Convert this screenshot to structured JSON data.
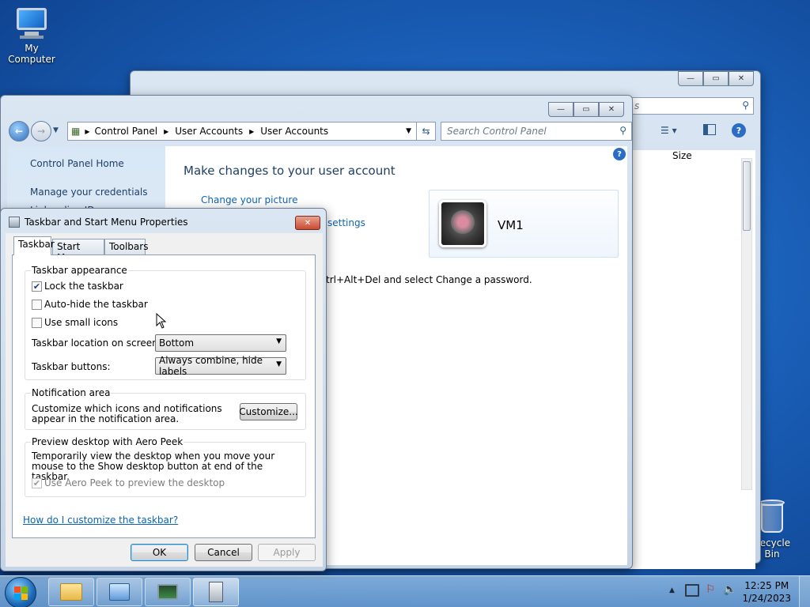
{
  "desktop": {
    "icons": [
      {
        "label": "My Computer"
      },
      {
        "label": "Recycle Bin"
      }
    ]
  },
  "explorer_window": {
    "search_partial": "s",
    "column_size": "Size"
  },
  "control_panel": {
    "breadcrumb": [
      "Control Panel",
      "User Accounts",
      "User Accounts"
    ],
    "search_placeholder": "Search Control Panel",
    "left_links": {
      "home": "Control Panel Home",
      "manage_credentials": "Manage your credentials",
      "partial": "Link online IDs"
    },
    "heading": "Make changes to your user account",
    "links": {
      "change_picture": "Change your picture",
      "settings_partial": "settings"
    },
    "password_text_partial": "trl+Alt+Del and select Change a password.",
    "user": {
      "name": "VM1"
    }
  },
  "taskbar_properties": {
    "title": "Taskbar and Start Menu Properties",
    "tabs": [
      "Taskbar",
      "Start Menu",
      "Toolbars"
    ],
    "active_tab": "Taskbar",
    "appearance": {
      "legend": "Taskbar appearance",
      "lock": {
        "label": "Lock the taskbar",
        "checked": true
      },
      "autohide": {
        "label": "Auto-hide the taskbar",
        "checked": false
      },
      "small_icons": {
        "label": "Use small icons",
        "checked": false
      },
      "location_label": "Taskbar location on screen:",
      "location_value": "Bottom",
      "buttons_label": "Taskbar buttons:",
      "buttons_value": "Always combine, hide labels"
    },
    "notification": {
      "legend": "Notification area",
      "text": "Customize which icons and notifications appear in the notification area.",
      "customize_button": "Customize..."
    },
    "aero_peek": {
      "legend": "Preview desktop with Aero Peek",
      "text": "Temporarily view the desktop when you move your mouse to the Show desktop button at end of the taskbar.",
      "checkbox": {
        "label": "Use Aero Peek to preview the desktop",
        "checked": true,
        "enabled": false
      }
    },
    "help_link": "How do I customize the taskbar?",
    "buttons": {
      "ok": "OK",
      "cancel": "Cancel",
      "apply": "Apply"
    }
  },
  "taskbar": {
    "clock": {
      "time": "12:25 PM",
      "date": "1/24/2023"
    }
  }
}
